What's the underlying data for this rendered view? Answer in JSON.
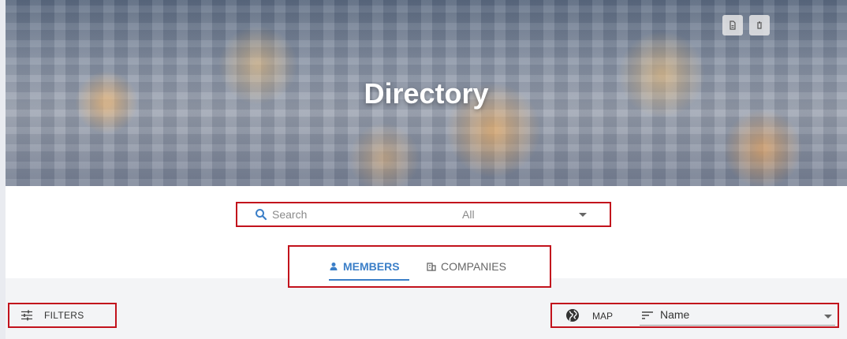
{
  "hero": {
    "title": "Directory",
    "actions": [
      {
        "icon": "file-export-icon"
      },
      {
        "icon": "trash-icon"
      }
    ]
  },
  "search": {
    "placeholder": "Search",
    "value": "",
    "scope": "All",
    "icon": "search-icon"
  },
  "tabs": [
    {
      "label": "MEMBERS",
      "icon": "person-icon",
      "active": true
    },
    {
      "label": "COMPANIES",
      "icon": "building-icon",
      "active": false
    }
  ],
  "toolbar": {
    "filters_label": "FILTERS",
    "map_label": "MAP",
    "sort_value": "Name"
  },
  "colors": {
    "accent": "#3b7fc8",
    "highlight_border": "#c2121c",
    "band": "#f3f4f6"
  }
}
